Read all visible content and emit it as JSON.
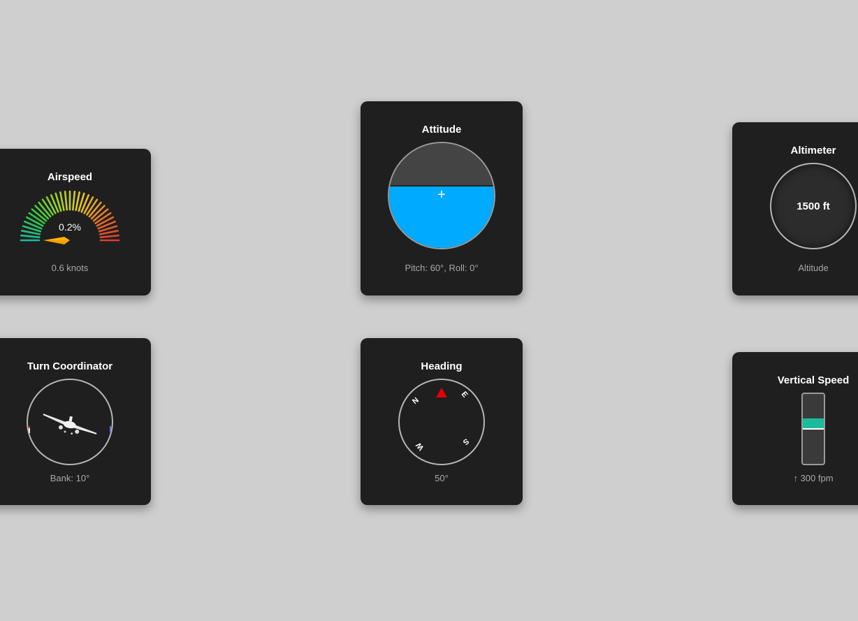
{
  "airspeed": {
    "title": "Airspeed",
    "percent": "0.2%",
    "caption": "0.6 knots"
  },
  "attitude": {
    "title": "Attitude",
    "center_mark": "+",
    "caption": "Pitch: 60°, Roll: 0°",
    "sky_color": "#444444",
    "ground_color": "#00aaff"
  },
  "altimeter": {
    "title": "Altimeter",
    "value": "1500 ft",
    "caption": "Altitude"
  },
  "turn": {
    "title": "Turn Coordinator",
    "caption": "Bank: 10°"
  },
  "heading": {
    "title": "Heading",
    "caption": "50°",
    "labels": {
      "n": "N",
      "e": "E",
      "s": "S",
      "w": "W"
    }
  },
  "vsi": {
    "title": "Vertical Speed",
    "caption": "↑ 300 fpm",
    "bar_color": "#1abc9c"
  },
  "icons": {
    "heading_pointer": "red-triangle-icon",
    "airplane": "airplane-icon"
  }
}
